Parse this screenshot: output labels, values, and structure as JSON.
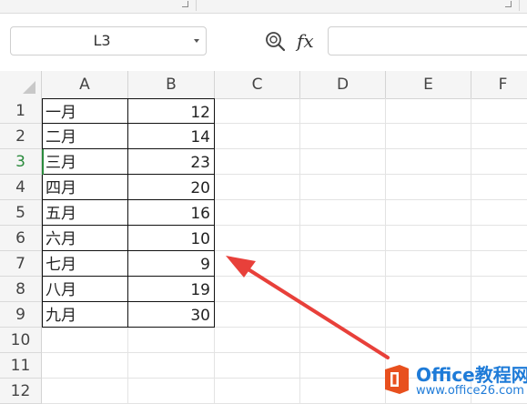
{
  "formula_bar": {
    "name_box_value": "L3",
    "fx_label": "fx",
    "formula_value": ""
  },
  "icons": {
    "zoom": "zoom-icon",
    "dropdown": "chevron-down-icon"
  },
  "columns": [
    "A",
    "B",
    "C",
    "D",
    "E",
    "F"
  ],
  "rows": [
    "1",
    "2",
    "3",
    "4",
    "5",
    "6",
    "7",
    "8",
    "9",
    "10",
    "11",
    "12"
  ],
  "active_row": "3",
  "table": [
    {
      "month": "一月",
      "value": "12"
    },
    {
      "month": "二月",
      "value": "14"
    },
    {
      "month": "三月",
      "value": "23"
    },
    {
      "month": "四月",
      "value": "20"
    },
    {
      "month": "五月",
      "value": "16"
    },
    {
      "month": "六月",
      "value": "10"
    },
    {
      "month": "七月",
      "value": "9"
    },
    {
      "month": "八月",
      "value": "19"
    },
    {
      "month": "九月",
      "value": "30"
    }
  ],
  "watermark": {
    "title": "Office教程网",
    "url": "www.office26.com"
  },
  "colors": {
    "accent_green": "#2a8a3c",
    "arrow_red": "#e8403a",
    "watermark_blue": "#1e7bd8",
    "watermark_orange": "#e8501e"
  }
}
